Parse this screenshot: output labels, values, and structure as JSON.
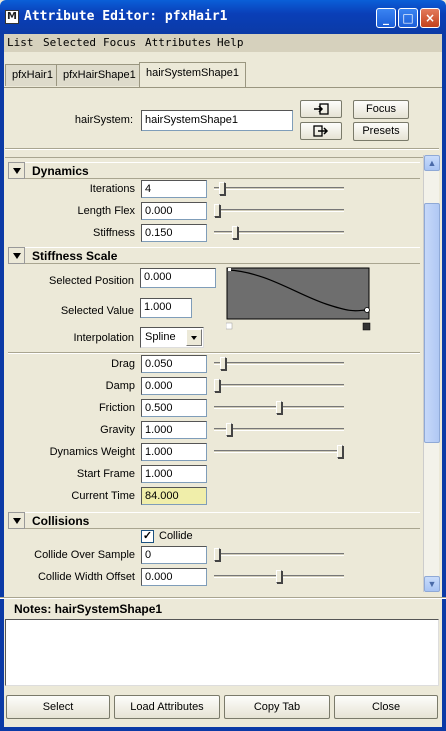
{
  "window": {
    "title": "Attribute Editor: pfxHair1",
    "app_icon": "M",
    "controls": {
      "minimize": "_",
      "maximize": "□",
      "close": "×"
    }
  },
  "menu": [
    "List",
    "Selected",
    "Focus",
    "Attributes",
    "Help"
  ],
  "tabs": [
    "pfxHair1",
    "pfxHairShape1",
    "hairSystemShape1"
  ],
  "header": {
    "node_label": "hairSystem:",
    "node_value": "hairSystemShape1",
    "focus_label": "Focus",
    "presets_label": "Presets",
    "icons": [
      "select-input-icon",
      "select-output-icon"
    ]
  },
  "dynamics": {
    "title": "Dynamics",
    "fields": [
      {
        "label": "Iterations",
        "value": "4",
        "slider": 0.04
      },
      {
        "label": "Length Flex",
        "value": "0.000",
        "slider": 0.0
      },
      {
        "label": "Stiffness",
        "value": "0.150",
        "slider": 0.15
      }
    ]
  },
  "stiffness_scale": {
    "title": "Stiffness Scale",
    "selected_position_label": "Selected Position",
    "selected_position": "0.000",
    "selected_value_label": "Selected Value",
    "selected_value": "1.000",
    "interpolation_label": "Interpolation",
    "interpolation": "Spline"
  },
  "params": [
    {
      "label": "Drag",
      "value": "0.050",
      "slider": 0.05
    },
    {
      "label": "Damp",
      "value": "0.000",
      "slider": 0.0
    },
    {
      "label": "Friction",
      "value": "0.500",
      "slider": 0.5
    },
    {
      "label": "Gravity",
      "value": "1.000",
      "slider": 0.1
    },
    {
      "label": "Dynamics Weight",
      "value": "1.000",
      "slider": 1.0
    },
    {
      "label": "Start Frame",
      "value": "1.000"
    },
    {
      "label": "Current Time",
      "value": "84.000"
    }
  ],
  "collisions": {
    "title": "Collisions",
    "collide_label": "Collide",
    "collide_checked": "✓",
    "fields": [
      {
        "label": "Collide Over Sample",
        "value": "0",
        "slider": 0.0
      },
      {
        "label": "Collide Width Offset",
        "value": "0.000",
        "slider": 0.5
      }
    ]
  },
  "notes": {
    "title": "Notes: hairSystemShape1",
    "content": ""
  },
  "footer": [
    "Select",
    "Load Attributes",
    "Copy Tab",
    "Close"
  ],
  "scrollbar": {
    "up": "▲",
    "down": "▼"
  }
}
